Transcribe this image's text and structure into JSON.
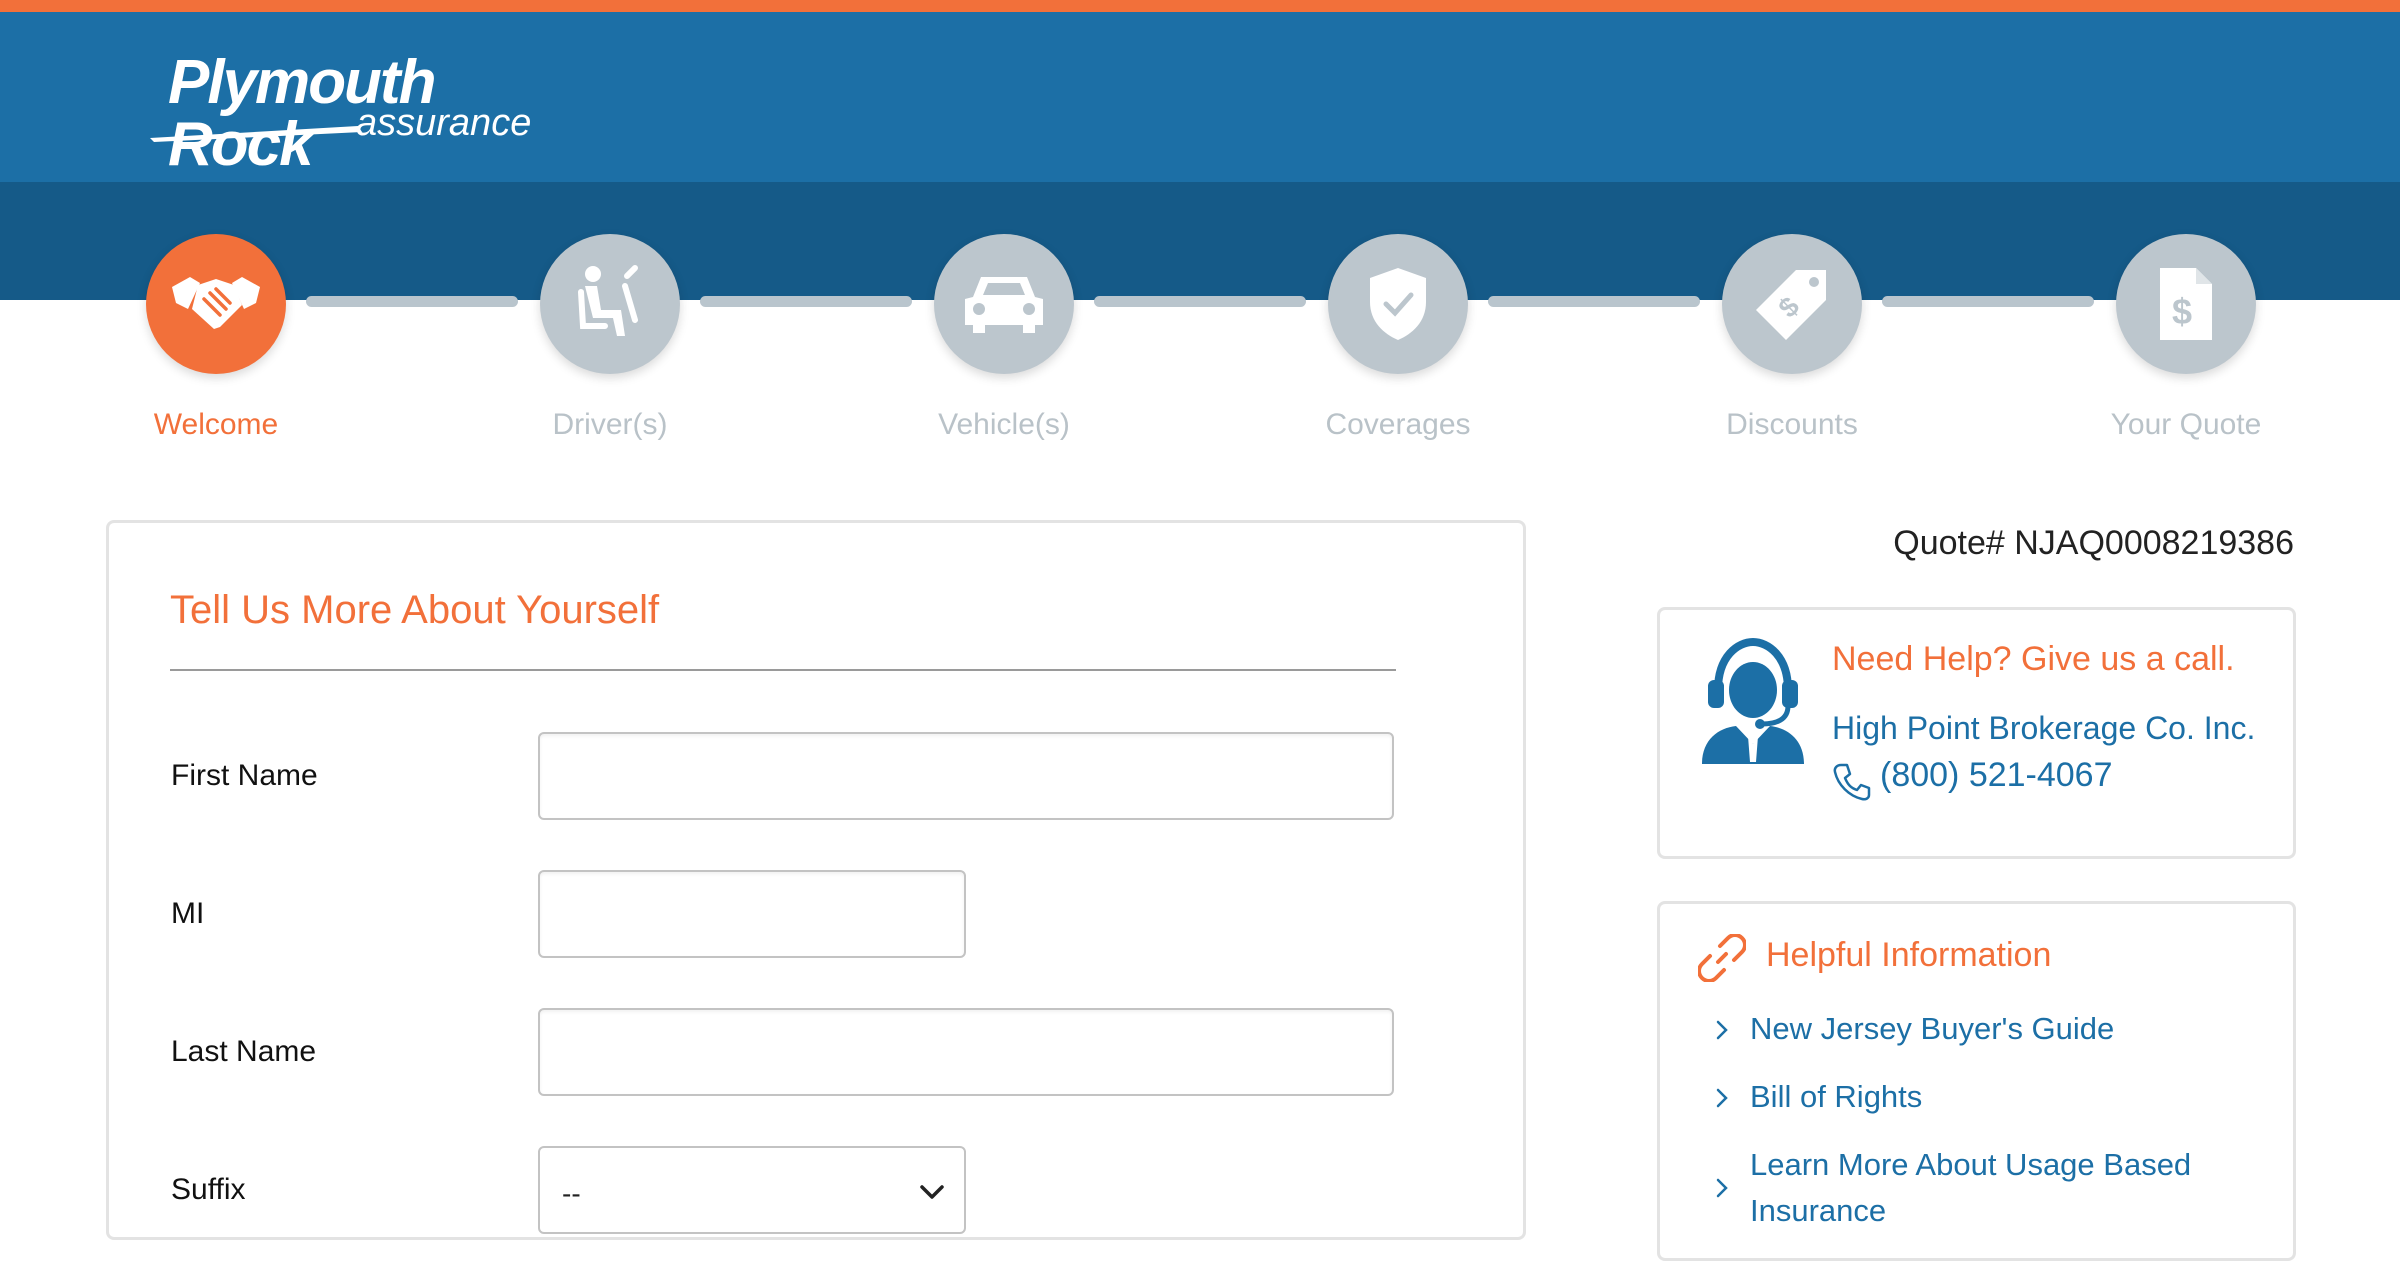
{
  "brand": {
    "name": "Plymouth Rock",
    "sub": "assurance",
    "primary_color": "#1c6fa6",
    "accent_color": "#f2703a"
  },
  "steps": [
    {
      "label": "Welcome",
      "icon": "handshake-icon",
      "active": true
    },
    {
      "label": "Driver(s)",
      "icon": "driver-icon",
      "active": false
    },
    {
      "label": "Vehicle(s)",
      "icon": "car-icon",
      "active": false
    },
    {
      "label": "Coverages",
      "icon": "shield-check-icon",
      "active": false
    },
    {
      "label": "Discounts",
      "icon": "price-tag-icon",
      "active": false
    },
    {
      "label": "Your Quote",
      "icon": "dollar-document-icon",
      "active": false
    }
  ],
  "form": {
    "title": "Tell Us More About Yourself",
    "fields": {
      "first_name": {
        "label": "First Name",
        "value": ""
      },
      "mi": {
        "label": "MI",
        "value": ""
      },
      "last_name": {
        "label": "Last Name",
        "value": ""
      },
      "suffix": {
        "label": "Suffix",
        "value": "--"
      }
    }
  },
  "quote": {
    "number_text": "Quote# NJAQ0008219386"
  },
  "help": {
    "title": "Need Help? Give us a call.",
    "company": "High Point Brokerage Co. Inc.",
    "phone": "(800) 521-4067"
  },
  "info": {
    "title": "Helpful Information",
    "links": [
      {
        "label": "New Jersey Buyer's Guide"
      },
      {
        "label": "Bill of Rights"
      },
      {
        "label": "Learn More About Usage Based Insurance"
      }
    ]
  }
}
